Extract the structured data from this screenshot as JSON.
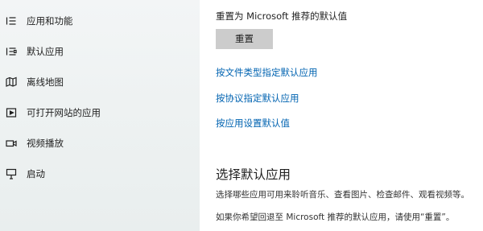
{
  "sidebar": {
    "items": [
      {
        "label": "应用和功能",
        "icon": "apps-list-icon"
      },
      {
        "label": "默认应用",
        "icon": "default-apps-icon"
      },
      {
        "label": "离线地图",
        "icon": "offline-maps-icon"
      },
      {
        "label": "可打开网站的应用",
        "icon": "apps-for-websites-icon"
      },
      {
        "label": "视频播放",
        "icon": "video-playback-icon"
      },
      {
        "label": "启动",
        "icon": "startup-icon"
      }
    ]
  },
  "main": {
    "reset": {
      "description": "重置为 Microsoft 推荐的默认值",
      "button_label": "重置"
    },
    "links": [
      "按文件类型指定默认应用",
      "按协议指定默认应用",
      "按应用设置默认值"
    ],
    "choose_section": {
      "title": "选择默认应用",
      "description": "选择哪些应用可用来聆听音乐、查看图片、检查邮件、观看视频等。",
      "note": "如果你希望回退至 Microsoft 推荐的默认应用，请使用“重置”。"
    }
  },
  "colors": {
    "link": "#0063b1",
    "button_bg": "#cccccc",
    "sidebar_bg": "#eef2f2"
  }
}
